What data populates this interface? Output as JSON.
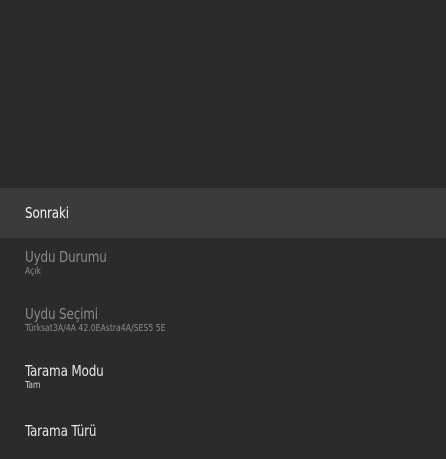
{
  "menu": {
    "items": [
      {
        "title": "Sonraki"
      },
      {
        "title": "Uydu Durumu",
        "value": "Açık"
      },
      {
        "title": "Uydu Seçimi",
        "value": "Türksat3A/4A 42.0EAstra4A/SES5 5E"
      },
      {
        "title": "Tarama Modu",
        "value": "Tam"
      },
      {
        "title": "Tarama Türü"
      }
    ]
  }
}
